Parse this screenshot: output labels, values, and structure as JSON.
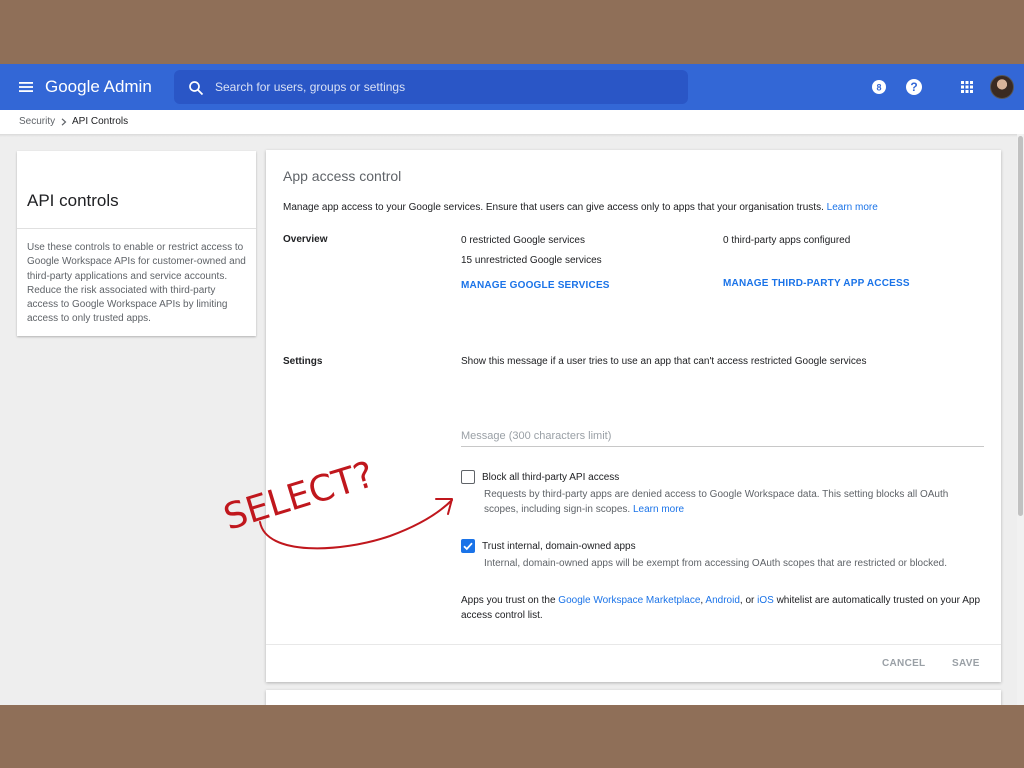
{
  "header": {
    "app_title": "Google Admin",
    "search_placeholder": "Search for users, groups or settings",
    "notification_count": "8",
    "help_label": "?"
  },
  "breadcrumb": {
    "items": [
      "Security",
      "API Controls"
    ]
  },
  "sidebar": {
    "title": "API controls",
    "description": "Use these controls to enable or restrict access to Google Workspace APIs for customer-owned and third-party applications and service accounts. Reduce the risk associated with third-party access to Google Workspace APIs by limiting access to only trusted apps."
  },
  "main": {
    "title": "App access control",
    "intro_text": "Manage app access to your Google services. Ensure that users can give access only to apps that your organisation trusts.",
    "intro_link": "Learn more",
    "overview": {
      "label": "Overview",
      "restricted": "0 restricted Google services",
      "unrestricted": "15 unrestricted Google services",
      "manage_google_link": "MANAGE GOOGLE SERVICES",
      "third_party": "0 third-party apps configured",
      "manage_third_party_link": "MANAGE THIRD-PARTY APP ACCESS"
    },
    "settings": {
      "label": "Settings",
      "description": "Show this message if a user tries to use an app that can't access restricted Google services",
      "message_placeholder": "Message (300 characters limit)",
      "block_all": {
        "label": "Block all third-party API access",
        "checked": false,
        "help": "Requests by third-party apps are denied access to Google Workspace data. This setting blocks all OAuth scopes, including sign-in scopes.",
        "help_link": "Learn more"
      },
      "trust_internal": {
        "label": "Trust internal, domain-owned apps",
        "checked": true,
        "help": "Internal, domain-owned apps will be exempt from accessing OAuth scopes that are restricted or blocked."
      },
      "note": {
        "prefix": "Apps you trust on the",
        "marketplace_link": "Google Workspace Marketplace",
        "comma": ",",
        "android_link": "Android",
        "or": ", or",
        "ios_link": "iOS",
        "suffix": "whitelist are automatically trusted on your App access control list."
      }
    },
    "buttons": {
      "cancel": "CANCEL",
      "save": "SAVE"
    }
  },
  "annotation": {
    "text": "SELECT?",
    "color": "#c0171d"
  },
  "colors": {
    "topbar": "#3367d6",
    "accent": "#1a73e8",
    "desk": "#8f6f58"
  }
}
